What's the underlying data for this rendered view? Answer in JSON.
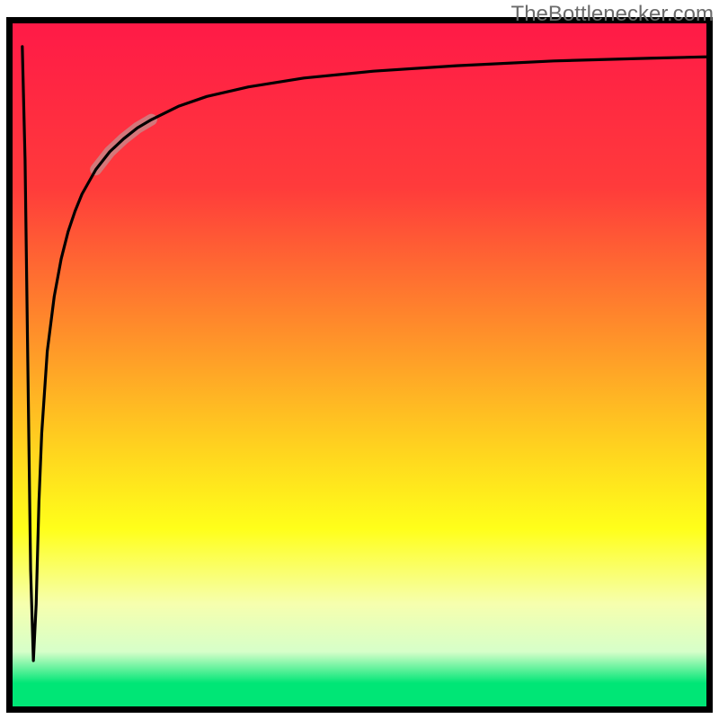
{
  "watermark": "TheBottlenecker.com",
  "chart_data": {
    "type": "line",
    "title": "",
    "xlabel": "",
    "ylabel": "",
    "xlim": [
      0,
      100
    ],
    "ylim": [
      0,
      100
    ],
    "grid": false,
    "border_color": "#000000",
    "border_width": 7,
    "background_gradient": {
      "direction": "vertical",
      "stops": [
        {
          "pos": 0.0,
          "color": "#ff1a47"
        },
        {
          "pos": 0.24,
          "color": "#ff3b3b"
        },
        {
          "pos": 0.44,
          "color": "#ff8a2b"
        },
        {
          "pos": 0.62,
          "color": "#ffd21f"
        },
        {
          "pos": 0.74,
          "color": "#ffff1a"
        },
        {
          "pos": 0.85,
          "color": "#f6ffae"
        },
        {
          "pos": 0.92,
          "color": "#d6ffc9"
        },
        {
          "pos": 0.966,
          "color": "#00e676"
        },
        {
          "pos": 1.0,
          "color": "#00e676"
        }
      ]
    },
    "curve": {
      "description": "Sharp narrow dip to y≈6 at x≈3, then asymptotic rise toward top",
      "color": "#000000",
      "width": 3.2,
      "highlight": {
        "color": "#c48f8f",
        "width": 13,
        "opacity": 0.75,
        "x_range": [
          12,
          20
        ]
      },
      "x": [
        1.4,
        1.8,
        2.2,
        2.6,
        3.0,
        3.4,
        3.8,
        4.2,
        5.0,
        6.0,
        7.0,
        8.0,
        9.0,
        10.0,
        12.0,
        14.0,
        16.0,
        18.0,
        20.0,
        24.0,
        28.0,
        34.0,
        42.0,
        52.0,
        64.0,
        78.0,
        92.0,
        100.0
      ],
      "y": [
        96.6,
        80.0,
        50.0,
        20.0,
        6.7,
        15.0,
        30.0,
        40.0,
        52.0,
        60.0,
        65.5,
        69.5,
        72.5,
        75.0,
        78.6,
        81.2,
        83.1,
        84.7,
        85.9,
        87.9,
        89.3,
        90.7,
        92.0,
        93.0,
        93.8,
        94.5,
        94.9,
        95.1
      ]
    }
  }
}
